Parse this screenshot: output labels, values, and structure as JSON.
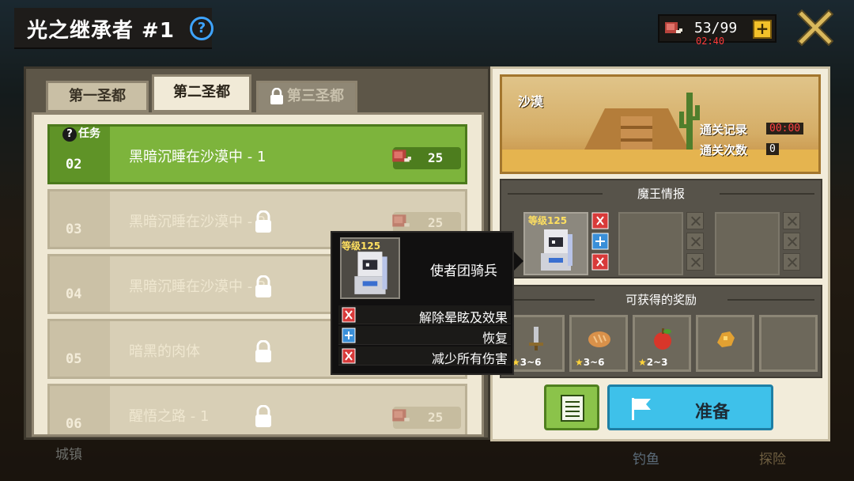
{
  "header": {
    "title": "光之继承者 #1",
    "help_icon": "question-circle-icon",
    "stamina": "53/99",
    "stamina_timer": "02:40",
    "close_icon": "close-x-icon"
  },
  "tabs": [
    {
      "label": "第一圣都",
      "state": "normal"
    },
    {
      "label": "第二圣都",
      "state": "active"
    },
    {
      "label": "第三圣都",
      "state": "locked"
    }
  ],
  "stages": [
    {
      "num": "02",
      "name": "黑暗沉睡在沙漠中 - 1",
      "cost": "25",
      "tag": "任务",
      "state": "active"
    },
    {
      "num": "03",
      "name": "黑暗沉睡在沙漠中 - 2",
      "cost": "25",
      "state": "locked"
    },
    {
      "num": "04",
      "name": "黑暗沉睡在沙漠中 - 3",
      "cost": "",
      "state": "locked"
    },
    {
      "num": "05",
      "name": "暗黑的肉体",
      "cost": "",
      "state": "locked"
    },
    {
      "num": "06",
      "name": "醒悟之路 - 1",
      "cost": "25",
      "state": "locked"
    }
  ],
  "tooltip": {
    "level": "等级125",
    "boss_name": "使者团骑兵",
    "skills": [
      {
        "label": "解除晕眩及效果",
        "color": "#d83a3a"
      },
      {
        "label": "恢复",
        "color": "#3a8fd8"
      },
      {
        "label": "减少所有伤害",
        "color": "#d83a3a"
      }
    ]
  },
  "area": {
    "name": "沙漠",
    "record_label": "通关记录",
    "record_value": "00:00",
    "clears_label": "通关次数",
    "clears_value": "0"
  },
  "boss_info": {
    "heading": "魔王情报",
    "level": "等级125"
  },
  "rewards": {
    "heading": "可获得的奖励",
    "items": [
      {
        "icon": "sword-icon",
        "stars": "3~6"
      },
      {
        "icon": "bread-icon",
        "stars": "3~6"
      },
      {
        "icon": "apple-icon",
        "stars": "2~3"
      },
      {
        "icon": "gold-ore-icon",
        "stars": ""
      },
      {
        "icon": "empty-slot",
        "stars": ""
      }
    ]
  },
  "actions": {
    "ready_label": "准备"
  },
  "background": {
    "town": "城镇",
    "fishing": "钓鱼",
    "adventure": "探险"
  },
  "colors": {
    "active_row": "#7db43c",
    "ready_button": "#3ec1ea",
    "list_button": "#8bc34a",
    "timer": "#ff3a3a"
  }
}
